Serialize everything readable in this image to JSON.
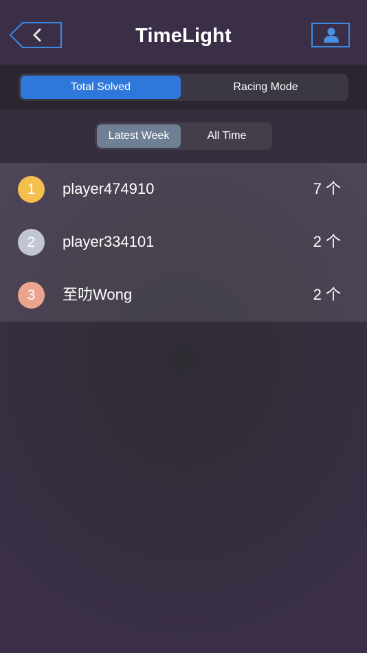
{
  "header": {
    "title": "TimeLight",
    "back_icon": "chevron-left-icon",
    "profile_icon": "user-icon",
    "accent_color": "#3a8be8"
  },
  "primary_tabs": {
    "selected": "Total Solved",
    "items": [
      {
        "label": "Total Solved"
      },
      {
        "label": "Racing Mode"
      }
    ]
  },
  "period_tabs": {
    "selected": "Latest Week",
    "items": [
      {
        "label": "Latest Week"
      },
      {
        "label": "All Time"
      }
    ]
  },
  "leaderboard": {
    "rows": [
      {
        "rank": "1",
        "name": "player474910",
        "count": "7 个",
        "badge_color": "#f5bf4f"
      },
      {
        "rank": "2",
        "name": "player334101",
        "count": "2 个",
        "badge_color": "#c2c5d6"
      },
      {
        "rank": "3",
        "name": "至叻Wong",
        "count": "2 个",
        "badge_color": "#eba48d"
      }
    ]
  }
}
